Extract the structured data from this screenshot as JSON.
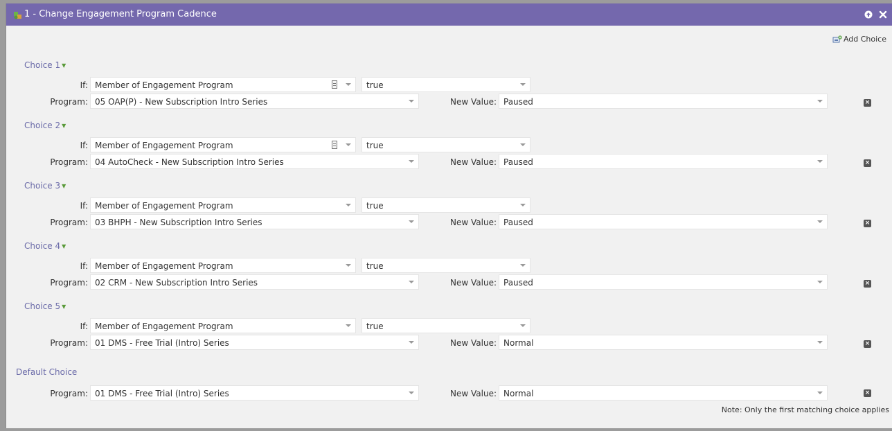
{
  "window": {
    "title": "1 - Change Engagement Program Cadence"
  },
  "toolbar": {
    "add_choice_label": "Add Choice"
  },
  "labels": {
    "if": "If:",
    "program": "Program:",
    "new_value": "New Value:"
  },
  "choices": [
    {
      "label": "Choice 1",
      "if_value": "Member of Engagement Program",
      "cond_value": "true",
      "program": "05 OAP(P) - New Subscription Intro Series",
      "new_value": "Paused",
      "has_doc_icon": true
    },
    {
      "label": "Choice 2",
      "if_value": "Member of Engagement Program",
      "cond_value": "true",
      "program": "04 AutoCheck - New Subscription Intro Series",
      "new_value": "Paused",
      "has_doc_icon": true
    },
    {
      "label": "Choice 3",
      "if_value": "Member of Engagement Program",
      "cond_value": "true",
      "program": "03 BHPH - New Subscription Intro Series",
      "new_value": "Paused",
      "has_doc_icon": false
    },
    {
      "label": "Choice 4",
      "if_value": "Member of Engagement Program",
      "cond_value": "true",
      "program": "02 CRM - New Subscription Intro Series",
      "new_value": "Paused",
      "has_doc_icon": false
    },
    {
      "label": "Choice 5",
      "if_value": "Member of Engagement Program",
      "cond_value": "true",
      "program": "01 DMS - Free Trial (Intro) Series",
      "new_value": "Normal",
      "has_doc_icon": false
    }
  ],
  "default_choice": {
    "label": "Default Choice",
    "program": "01 DMS - Free Trial (Intro) Series",
    "new_value": "Normal"
  },
  "note": "Note: Only the first matching choice applies",
  "icons": {
    "title_icon": "flow-step-icon",
    "collapse": "arrow-up-icon",
    "close": "close-icon",
    "add_choice": "add-choice-icon",
    "delete": "delete-icon"
  },
  "colors": {
    "titlebar": "#7468ad",
    "choice_label": "#6a6aa8",
    "panel_bg": "#f1f1f1"
  }
}
